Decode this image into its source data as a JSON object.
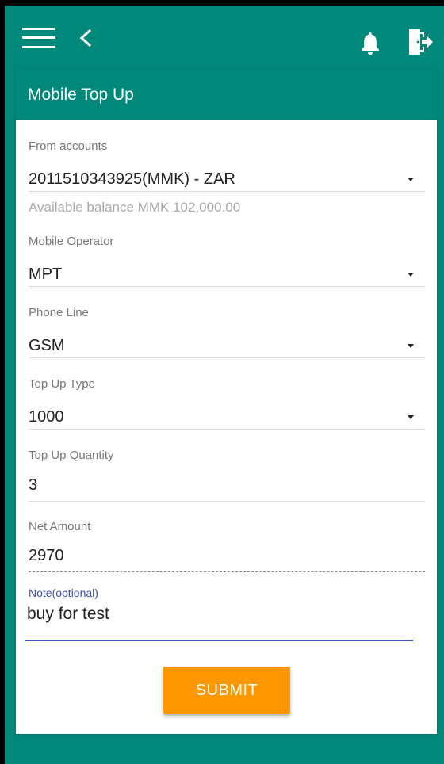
{
  "app_bar": {
    "menu_icon": "menu-icon",
    "back_icon": "back-icon",
    "notifications_icon": "bell-icon",
    "logout_icon": "logout-icon",
    "background_color": "#00897b"
  },
  "card": {
    "title": "Mobile Top Up"
  },
  "form": {
    "from_accounts": {
      "label": "From accounts",
      "value": "2011510343925(MMK) - ZAR",
      "helper": "Available balance MMK 102,000.00"
    },
    "mobile_operator": {
      "label": "Mobile Operator",
      "value": "MPT"
    },
    "phone_line": {
      "label": "Phone Line",
      "value": "GSM"
    },
    "top_up_type": {
      "label": "Top Up Type",
      "value": "1000"
    },
    "top_up_quantity": {
      "label": "Top Up Quantity",
      "value": "3"
    },
    "net_amount": {
      "label": "Net Amount",
      "value": "2970"
    },
    "note": {
      "label": "Note(optional)",
      "value": "buy for test"
    },
    "submit_label": "SUBMIT"
  },
  "colors": {
    "primary": "#00897b",
    "accent": "#ff9800",
    "focus": "#3f51b5"
  }
}
